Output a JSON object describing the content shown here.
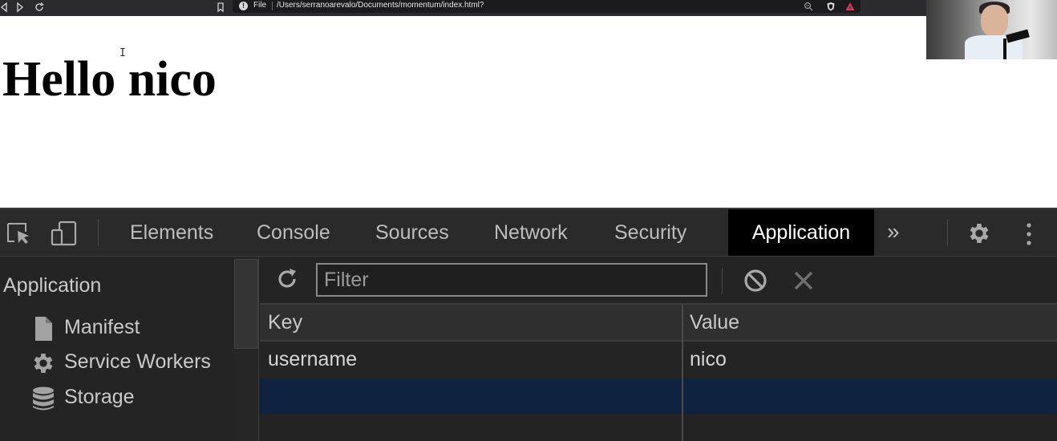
{
  "browser": {
    "scheme": "File",
    "url": "/Users/serranoarevalo/Documents/momentum/index.html?",
    "info_glyph": "!",
    "nav_icons": [
      "back-icon",
      "forward-icon",
      "reload-icon",
      "bookmark-icon"
    ],
    "right_icons": [
      "zoom-out-icon",
      "brave-shield-icon",
      "brave-rewards-icon"
    ]
  },
  "page": {
    "heading": "Hello nico",
    "cursor_glyph": "I"
  },
  "devtools": {
    "tabs": [
      {
        "label": "Elements",
        "active": false
      },
      {
        "label": "Console",
        "active": false
      },
      {
        "label": "Sources",
        "active": false
      },
      {
        "label": "Network",
        "active": false
      },
      {
        "label": "Security",
        "active": false
      },
      {
        "label": "Application",
        "active": true
      }
    ],
    "more_tabs": "»",
    "colors": {
      "toolbar_bg": "#2a2a2a",
      "active_tab_bg": "#000000",
      "selected_row_bg": "#0f2340",
      "text": "#c9c9c9"
    },
    "sidebar": {
      "heading": "Application",
      "items": [
        {
          "label": "Manifest",
          "icon": "document-icon"
        },
        {
          "label": "Service Workers",
          "icon": "gear-icon"
        },
        {
          "label": "Storage",
          "icon": "database-icon"
        }
      ]
    },
    "storage": {
      "filter_placeholder": "Filter",
      "filter_value": "",
      "columns": [
        "Key",
        "Value"
      ],
      "rows": [
        {
          "key": "username",
          "value": "nico"
        },
        {
          "key": "",
          "value": ""
        }
      ],
      "selected_row": 1
    }
  }
}
